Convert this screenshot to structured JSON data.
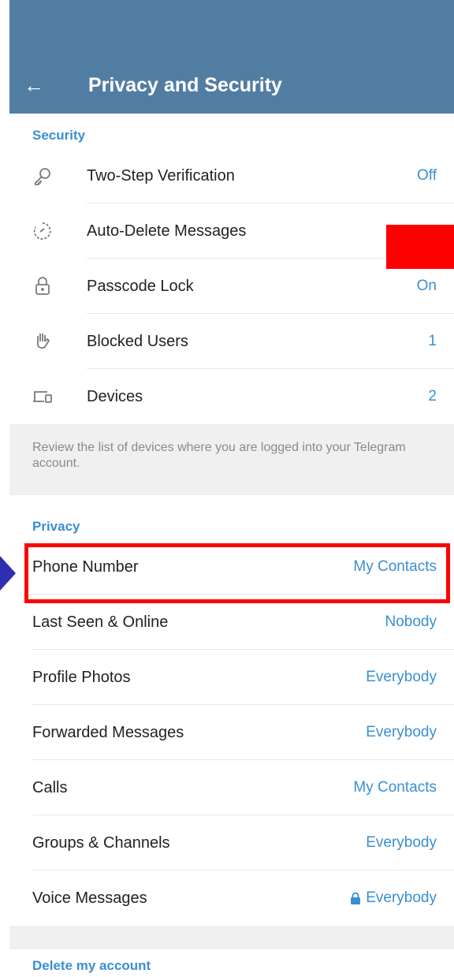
{
  "header": {
    "title": "Privacy and Security"
  },
  "security": {
    "title": "Security",
    "items": [
      {
        "label": "Two-Step Verification",
        "value": "Off",
        "icon": "key-icon"
      },
      {
        "label": "Auto-Delete Messages",
        "value": "",
        "icon": "timer-icon"
      },
      {
        "label": "Passcode Lock",
        "value": "On",
        "icon": "lock-icon"
      },
      {
        "label": "Blocked Users",
        "value": "1",
        "icon": "hand-icon"
      },
      {
        "label": "Devices",
        "value": "2",
        "icon": "devices-icon"
      }
    ],
    "info": "Review the list of devices where you are logged into your Telegram account."
  },
  "privacy": {
    "title": "Privacy",
    "items": [
      {
        "label": "Phone Number",
        "value": "My Contacts"
      },
      {
        "label": "Last Seen & Online",
        "value": "Nobody"
      },
      {
        "label": "Profile Photos",
        "value": "Everybody"
      },
      {
        "label": "Forwarded Messages",
        "value": "Everybody"
      },
      {
        "label": "Calls",
        "value": "My Contacts"
      },
      {
        "label": "Groups & Channels",
        "value": "Everybody"
      },
      {
        "label": "Voice Messages",
        "value": "Everybody",
        "icon": "lock-icon"
      }
    ]
  },
  "delete_account": {
    "title": "Delete my account"
  },
  "colors": {
    "appbar": "#527da3",
    "accent": "#3a8fd0",
    "highlight": "#ff0000",
    "arrow": "#2d2fb0"
  }
}
